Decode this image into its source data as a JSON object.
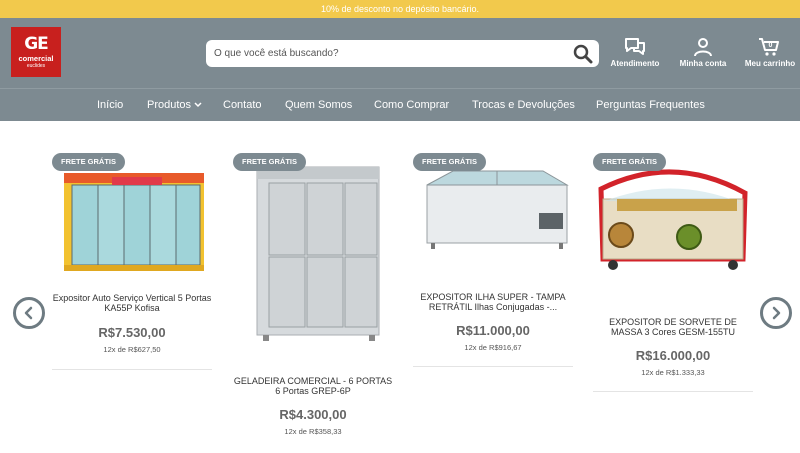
{
  "topbar": {
    "text": "10% de desconto no depósito bancário."
  },
  "logo": {
    "mark": "GE",
    "brand": "comercial",
    "sub": "euclides"
  },
  "search": {
    "placeholder": "O que você está buscando?"
  },
  "header_actions": [
    {
      "label": "Atendimento",
      "icon": "chat-icon"
    },
    {
      "label": "Minha conta",
      "icon": "user-icon"
    },
    {
      "label": "Meu carrinho",
      "icon": "cart-icon",
      "count": "0"
    }
  ],
  "nav": [
    {
      "label": "Início"
    },
    {
      "label": "Produtos"
    },
    {
      "label": "Contato"
    },
    {
      "label": "Quem Somos"
    },
    {
      "label": "Como Comprar"
    },
    {
      "label": "Trocas e Devoluções"
    },
    {
      "label": "Perguntas Frequentes"
    }
  ],
  "products": [
    {
      "badge": "FRETE GRÁTIS",
      "name": "Expositor Auto Serviço Vertical 5 Portas KA55P Kofisa",
      "price": "R$7.530,00",
      "installments": "12x de R$627,50"
    },
    {
      "badge": "FRETE GRÁTIS",
      "name": "GELADEIRA COMERCIAL - 6 PORTAS 6 Portas GREP-6P",
      "price": "R$4.300,00",
      "installments": "12x de R$358,33"
    },
    {
      "badge": "FRETE GRÁTIS",
      "name": "EXPOSITOR ILHA SUPER - TAMPA RETRÁTIL Ilhas Conjugadas -...",
      "price": "R$11.000,00",
      "installments": "12x de R$916,67"
    },
    {
      "badge": "FRETE GRÁTIS",
      "name": "EXPOSITOR DE SORVETE DE MASSA 3 Cores GESM-155TU",
      "price": "R$16.000,00",
      "installments": "12x de R$1.333,33"
    }
  ],
  "colors": {
    "topbar": "#f2c94c",
    "header": "#7d8a91",
    "logo": "#c8201e"
  }
}
